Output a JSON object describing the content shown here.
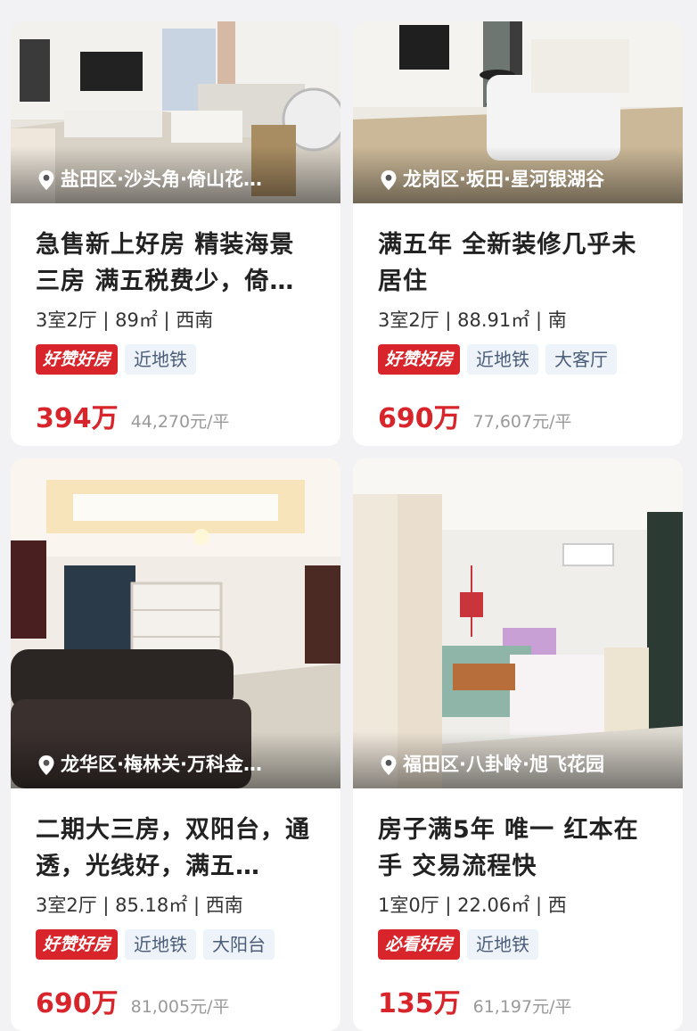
{
  "listings": [
    {
      "location": "盐田区·沙头角·倚山花…",
      "title": "急售新上好房 精装海景三房 满五税费少，倚…",
      "specs": "3室2厅 | 89㎡ | 西南",
      "badge": "好赞好房",
      "tags": [
        "近地铁"
      ],
      "price": "394万",
      "unit_price": "44,270元/平"
    },
    {
      "location": "龙岗区·坂田·星河银湖谷",
      "title": "满五年 全新装修几乎未居住",
      "specs": "3室2厅 | 88.91㎡ | 南",
      "badge": "好赞好房",
      "tags": [
        "近地铁",
        "大客厅"
      ],
      "price": "690万",
      "unit_price": "77,607元/平"
    },
    {
      "location": "龙华区·梅林关·万科金…",
      "title": "二期大三房，双阳台，通透，光线好，满五…",
      "specs": "3室2厅 | 85.18㎡ | 西南",
      "badge": "好赞好房",
      "tags": [
        "近地铁",
        "大阳台"
      ],
      "price": "690万",
      "unit_price": "81,005元/平"
    },
    {
      "location": "福田区·八卦岭·旭飞花园",
      "title": "房子满5年 唯一 红本在手 交易流程快",
      "specs": "1室0厅 | 22.06㎡ | 西",
      "badge": "必看好房",
      "tags": [
        "近地铁"
      ],
      "price": "135万",
      "unit_price": "61,197元/平"
    }
  ],
  "colors": {
    "price": "#d7252b",
    "badge_bg": "#d7252b",
    "tag_bg": "#eef3f9",
    "tag_text": "#4a5c78"
  },
  "icons": {
    "location": "location-pin-icon"
  }
}
